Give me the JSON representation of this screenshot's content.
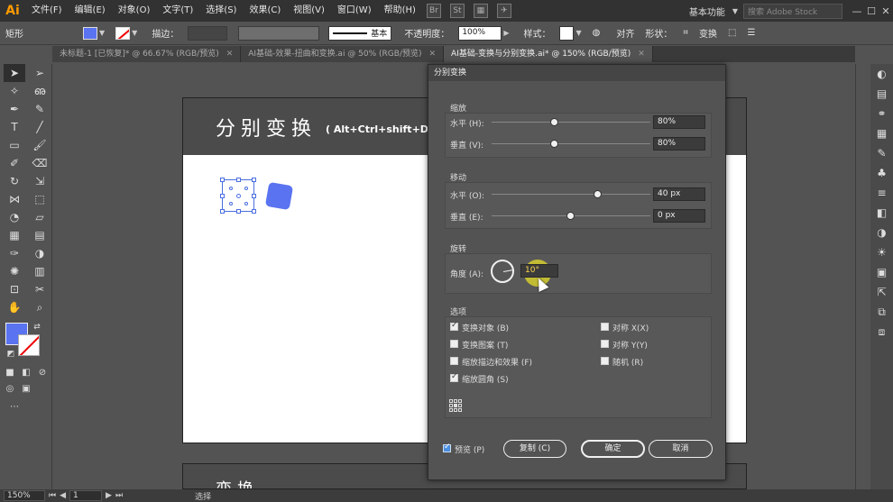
{
  "menubar": {
    "logo": "Ai",
    "items": [
      "文件(F)",
      "编辑(E)",
      "对象(O)",
      "文字(T)",
      "选择(S)",
      "效果(C)",
      "视图(V)",
      "窗口(W)",
      "帮助(H)"
    ],
    "icons": [
      "Br",
      "St"
    ],
    "workspace": "基本功能",
    "search_placeholder": "搜索 Adobe Stock"
  },
  "controlbar": {
    "object_type": "矩形",
    "stroke_label": "描边：",
    "stroke_style": "基本",
    "opacity_label": "不透明度：",
    "opacity_value": "100%",
    "style_label": "样式：",
    "align_label": "对齐",
    "shape_label": "形状：",
    "transform_label": "变换",
    "fill_color": "#5a73f0"
  },
  "tabs": [
    {
      "label": "未标题-1 [已恢复]* @ 66.67% (RGB/预览)",
      "active": false
    },
    {
      "label": "AI基础-效果-扭曲和变换.ai @ 50% (RGB/预览)",
      "active": false
    },
    {
      "label": "AI基础-变换与分别变换.ai* @ 150% (RGB/预览)",
      "active": true
    }
  ],
  "artboard": {
    "title": "分别变换",
    "subtitle": "( Alt+Ctrl+shift+D",
    "second_title": "变换"
  },
  "statusbar": {
    "zoom": "150%",
    "page": "1",
    "mode": "选择"
  },
  "dialog": {
    "title": "分别变换",
    "scale": {
      "label": "缩放",
      "horizontal_label": "水平 (H):",
      "horizontal_value": "80%",
      "horizontal_fraction": 0.4,
      "vertical_label": "垂直 (V):",
      "vertical_value": "80%",
      "vertical_fraction": 0.4
    },
    "move": {
      "label": "移动",
      "horizontal_label": "水平 (O):",
      "horizontal_value": "40 px",
      "horizontal_fraction": 0.67,
      "vertical_label": "垂直 (E):",
      "vertical_value": "0 px",
      "vertical_fraction": 0.5
    },
    "rotate": {
      "label": "旋转",
      "angle_label": "角度 (A):",
      "angle_value": "10°"
    },
    "options": {
      "label": "选项",
      "transform_objects": {
        "label": "变换对象 (B)",
        "checked": true
      },
      "transform_patterns": {
        "label": "变换图案 (T)",
        "checked": false
      },
      "scale_strokes": {
        "label": "缩放描边和效果 (F)",
        "checked": false
      },
      "scale_corners": {
        "label": "缩放圆角 (S)",
        "checked": true
      },
      "reflect_x": {
        "label": "对称 X(X)",
        "checked": false
      },
      "reflect_y": {
        "label": "对称 Y(Y)",
        "checked": false
      },
      "random": {
        "label": "随机 (R)",
        "checked": false
      }
    },
    "preview_label": "预览 (P)",
    "copy_label": "复制 (C)",
    "ok_label": "确定",
    "cancel_label": "取消"
  }
}
